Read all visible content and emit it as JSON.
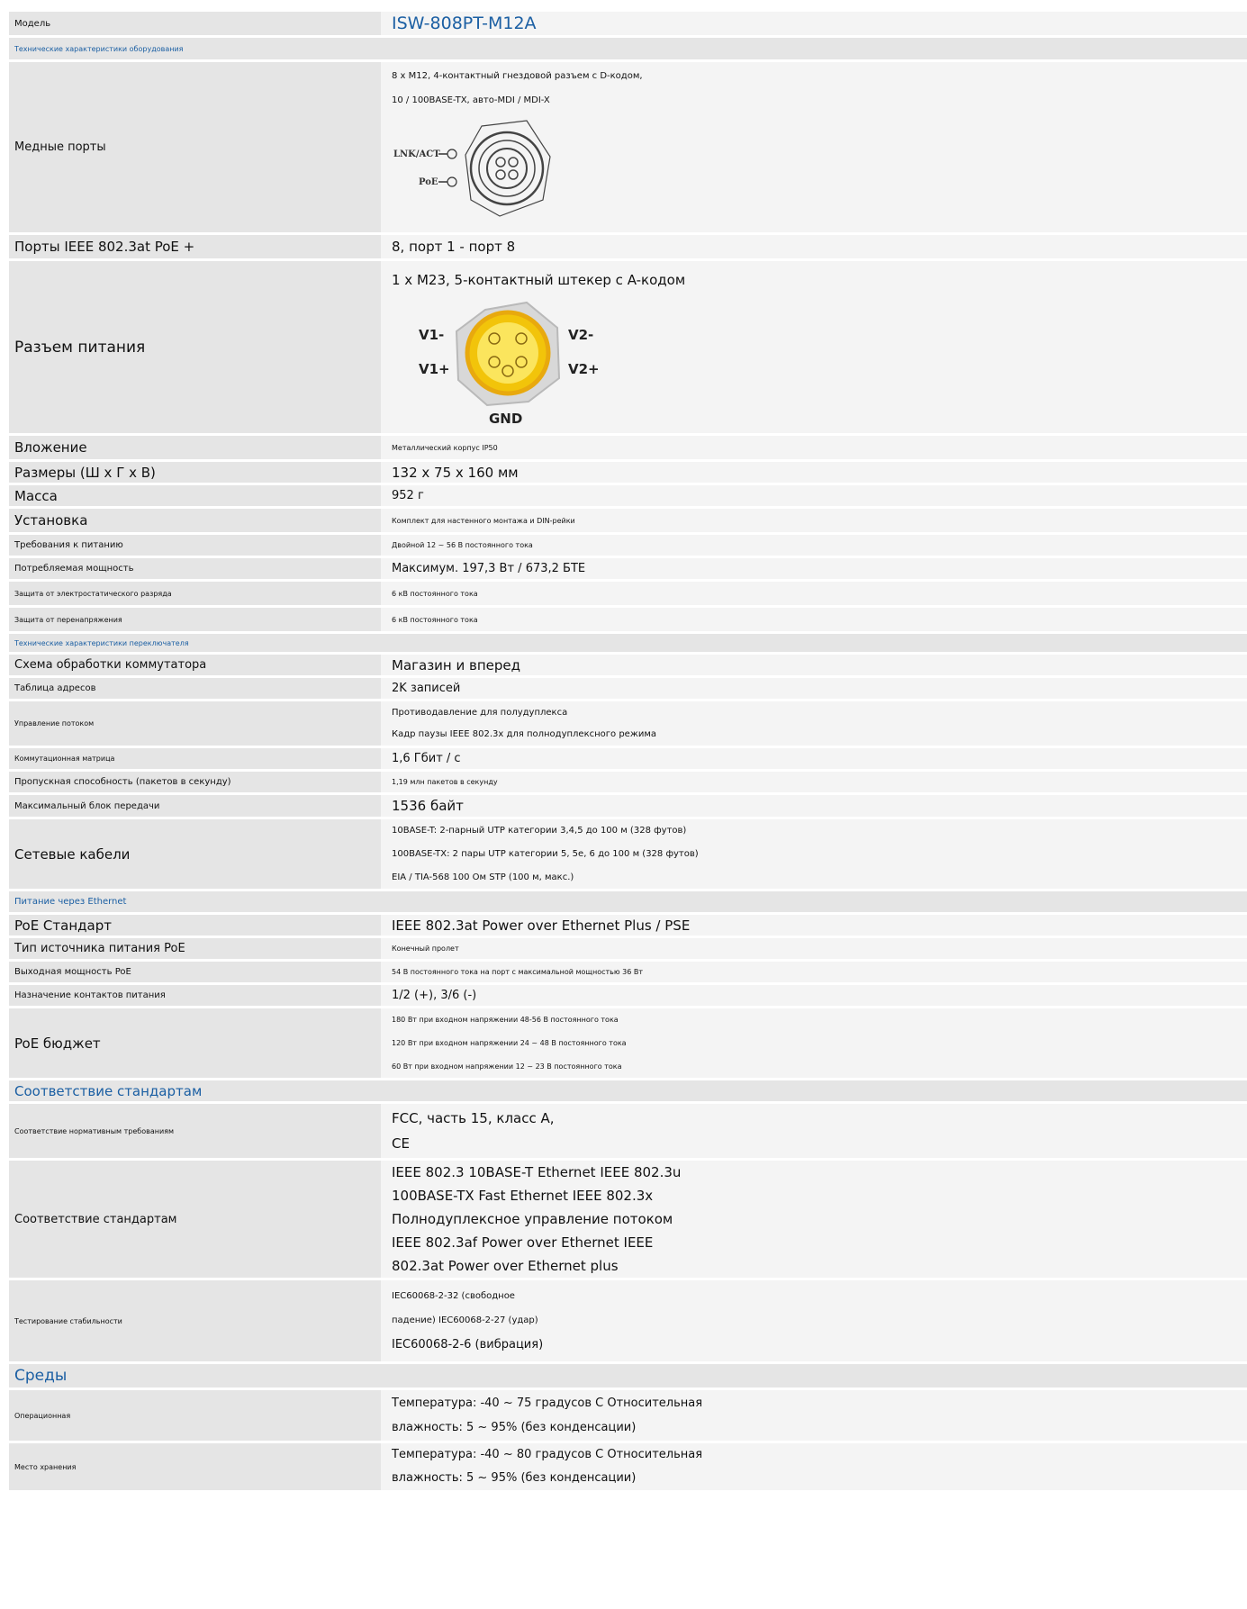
{
  "model": {
    "label": "Модель",
    "value": "ISW-808PT-M12A"
  },
  "sections": {
    "hardware": "Технические характеристики оборудования",
    "switch": "Технические характеристики переключателя",
    "poe": "Питание через Ethernet",
    "standards": "Соответствие стандартам",
    "environment": "Среды"
  },
  "copper": {
    "label": "Медные порты",
    "lines": [
      "8 x M12, 4-контактный гнездовой разъем с D-кодом,",
      "10 / 100BASE-TX, авто-MDI / MDI-X"
    ],
    "diagram": {
      "lnk_act": "LNK/ACT",
      "poe": "PoE"
    }
  },
  "poe_ports": {
    "label": "Порты IEEE 802.3at PoE +",
    "value": "8, порт 1 - порт 8"
  },
  "power_connector": {
    "label": "Разъем питания",
    "value": "1 x M23, 5-контактный штекер с A-кодом",
    "diagram": {
      "v1m": "V1-",
      "v1p": "V1+",
      "v2m": "V2-",
      "v2p": "V2+",
      "gnd": "GND"
    }
  },
  "enclosure": {
    "label": "Вложение",
    "value": "Металлический корпус IP50"
  },
  "dimensions": {
    "label": "Размеры (Ш x Г x В)",
    "value": "132 x 75 x 160 мм"
  },
  "weight": {
    "label": "Масса",
    "value": "952 г"
  },
  "installation": {
    "label": "Установка",
    "value": "Комплект для настенного монтажа и DIN-рейки"
  },
  "power_req": {
    "label": "Требования к питанию",
    "value": "Двойной 12 ~ 56 В постоянного тока"
  },
  "power_consumption": {
    "label": "Потребляемая мощность",
    "value": "Максимум. 197,3 Вт / 673,2 БТЕ"
  },
  "esd": {
    "label": "Защита от электростатического разряда",
    "value": "6 кВ постоянного тока"
  },
  "surge": {
    "label": "Защита от перенапряжения",
    "value": "6 кВ постоянного тока"
  },
  "switch_arch": {
    "label": "Схема обработки коммутатора",
    "value": "Магазин и вперед"
  },
  "address_table": {
    "label": "Таблица адресов",
    "value": "2K записей"
  },
  "flow_control": {
    "label": "Управление потоком",
    "lines": [
      "Противодавление для полудуплекса",
      "Кадр паузы IEEE 802.3x для полнодуплексного режима"
    ]
  },
  "switch_fabric": {
    "label": "Коммутационная матрица",
    "value": "1,6 Гбит / с"
  },
  "throughput": {
    "label": "Пропускная способность (пакетов в секунду)",
    "value": "1,19 млн пакетов в секунду"
  },
  "mtu": {
    "label": "Максимальный блок передачи",
    "value": "1536 байт"
  },
  "cables": {
    "label": "Сетевые кабели",
    "lines": [
      "10BASE-T: 2-парный UTP категории 3,4,5 до 100 м (328 футов)",
      "100BASE-TX: 2 пары UTP категории 5, 5e, 6 до 100 м (328 футов)",
      "EIA / TIA-568 100 Ом STP (100 м, макс.)"
    ]
  },
  "poe_standard": {
    "label": "PoE Стандарт",
    "value": "IEEE 802.3at Power over Ethernet Plus / PSE"
  },
  "poe_source": {
    "label": "Тип источника питания PoE",
    "value": "Конечный пролет"
  },
  "poe_output": {
    "label": "Выходная мощность PoE",
    "value": "54 В постоянного тока на порт с максимальной мощностью 36 Вт"
  },
  "pin_assign": {
    "label": "Назначение контактов питания",
    "value": "1/2 (+), 3/6 (-)"
  },
  "poe_budget": {
    "label": "PoE бюджет",
    "lines": [
      "180 Вт при входном напряжении 48-56 В постоянного тока",
      "120 Вт при входном напряжении 24 ~ 48 В постоянного тока",
      "60 Вт при входном напряжении 12 ~ 23 В постоянного тока"
    ]
  },
  "regulatory": {
    "label": "Соответствие нормативным требованиям",
    "lines": [
      "FCC, часть 15, класс A,",
      "CE"
    ]
  },
  "standards": {
    "label": "Соответствие стандартам",
    "lines": [
      "IEEE 802.3 10BASE-T Ethernet IEEE 802.3u",
      "100BASE-TX Fast Ethernet IEEE 802.3x",
      "Полнодуплексное управление потоком",
      "IEEE 802.3af Power over Ethernet IEEE",
      "802.3at Power over Ethernet plus"
    ]
  },
  "stability": {
    "label": "Тестирование стабильности",
    "lines": [
      "IEC60068-2-32 (свободное",
      "падение) IEC60068-2-27 (удар)",
      "IEC60068-2-6 (вибрация)"
    ]
  },
  "operating": {
    "label": "Операционная",
    "lines": [
      "Температура: -40 ~ 75 градусов C Относительная",
      "влажность: 5 ~ 95% (без конденсации)"
    ]
  },
  "storage": {
    "label": "Место хранения",
    "lines": [
      "Температура: -40 ~ 80 градусов C Относительная",
      "влажность: 5 ~ 95% (без конденсации)"
    ]
  },
  "colors": {
    "section_text": "#1b5fa3",
    "label_bg": "#e5e5e5",
    "value_bg": "#f4f4f4"
  }
}
